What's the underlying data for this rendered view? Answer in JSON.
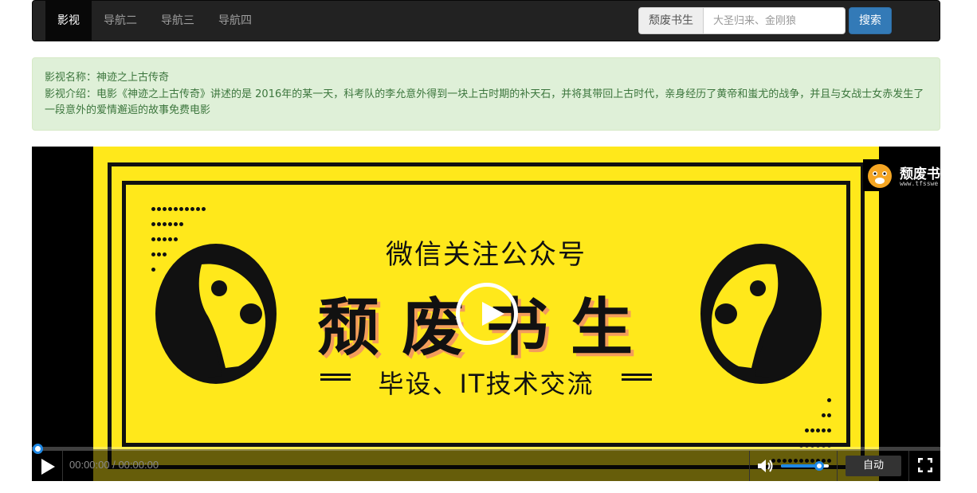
{
  "navbar": {
    "items": [
      {
        "label": "影视",
        "active": true
      },
      {
        "label": "导航二",
        "active": false
      },
      {
        "label": "导航三",
        "active": false
      },
      {
        "label": "导航四",
        "active": false
      }
    ],
    "search": {
      "addon": "颓废书生",
      "placeholder": "大圣归来、金刚狼",
      "button": "搜索"
    }
  },
  "movie": {
    "name_label": "影视名称：",
    "name": "神迹之上古传奇",
    "intro_label": "影视介绍：",
    "intro": "电影《神迹之上古传奇》讲述的是 2016年的某一天，科考队的李允意外得到一块上古时期的补天石，并将其带回上古时代，亲身经历了黄帝和蚩尤的战争，并且与女战士女赤发生了一段意外的爱情邂逅的故事免费电影"
  },
  "poster": {
    "subtitle": "微信关注公众号",
    "title": "颓废书生",
    "tagline": "毕设、IT技术交流",
    "logo_text": "颓废书",
    "logo_url": "www.tfsswe"
  },
  "player": {
    "time": "00:00:00 / 00:00:00",
    "quality": "自动",
    "progress": 0,
    "volume": 0.8,
    "accent": "#1e88e5"
  },
  "colors": {
    "navbar_bg": "#222222",
    "alert_bg": "#dff0d8",
    "alert_text": "#3c763d",
    "search_button": "#337ab7",
    "poster_bg": "#ffe81b"
  }
}
